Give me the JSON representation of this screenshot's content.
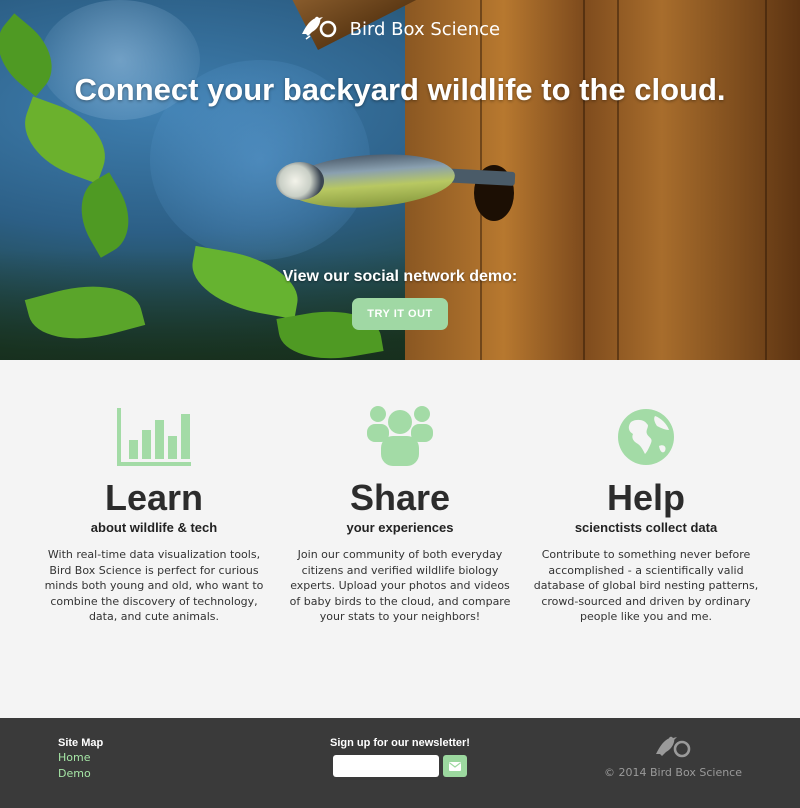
{
  "brand": {
    "name": "Bird Box Science",
    "logo_icon": "bird-magnifier-icon"
  },
  "hero": {
    "headline": "Connect your backyard wildlife to the cloud.",
    "demo_label": "View our social network demo:",
    "cta_label": "TRY IT OUT",
    "cta_color": "#a0d8a4"
  },
  "features": [
    {
      "icon": "bar-chart-icon",
      "title": "Learn",
      "subtitle": "about wildlife & tech",
      "description": "With real-time data visualization tools, Bird Box Science is perfect for curious minds both young and old, who want to combine the discovery of technology, data, and cute animals."
    },
    {
      "icon": "people-group-icon",
      "title": "Share",
      "subtitle": "your experiences",
      "description": "Join our community of both everyday citizens and verified wildlife biology experts. Upload your photos and videos of baby birds to the cloud, and compare your stats to your neighbors!"
    },
    {
      "icon": "globe-icon",
      "title": "Help",
      "subtitle": "scienctists collect data",
      "description": "Contribute to something never before accomplished - a scientifically valid database of global bird nesting patterns, crowd-sourced and driven by ordinary people like you and me."
    }
  ],
  "footer": {
    "sitemap": {
      "heading": "Site Map",
      "links": [
        "Home",
        "Demo"
      ]
    },
    "newsletter": {
      "heading": "Sign up for our newsletter!",
      "input_value": "",
      "send_icon": "envelope-icon"
    },
    "copyright": "© 2014 Bird Box Science",
    "accent_color": "#a6e6a6"
  }
}
